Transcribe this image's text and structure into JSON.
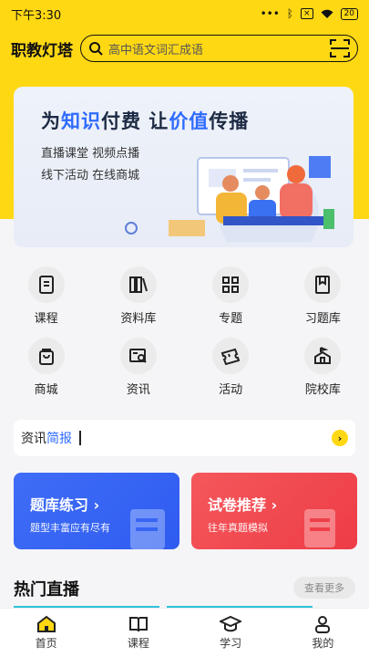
{
  "status": {
    "time": "下午3:30",
    "battery": "20"
  },
  "header": {
    "title": "职教灯塔",
    "search_placeholder": "高中语文词汇成语"
  },
  "banner": {
    "title_a": "为",
    "title_b": "知识",
    "title_c": "付费 让",
    "title_d": "价值",
    "title_e": "传播",
    "line1": "直播课堂 视频点播",
    "line2": "线下活动 在线商城"
  },
  "menu": [
    {
      "label": "课程",
      "icon": "book-icon"
    },
    {
      "label": "资料库",
      "icon": "library-icon"
    },
    {
      "label": "专题",
      "icon": "grid-icon"
    },
    {
      "label": "习题库",
      "icon": "question-book-icon"
    },
    {
      "label": "商城",
      "icon": "shopping-bag-icon"
    },
    {
      "label": "资讯",
      "icon": "news-search-icon"
    },
    {
      "label": "活动",
      "icon": "ticket-icon"
    },
    {
      "label": "院校库",
      "icon": "school-icon"
    }
  ],
  "news": {
    "label_a": "资讯",
    "label_b": "简报"
  },
  "cards": {
    "practice": {
      "title": "题库练习 ›",
      "subtitle": "题型丰富应有尽有"
    },
    "papers": {
      "title": "试卷推荐 ›",
      "subtitle": "往年真题模拟"
    }
  },
  "live": {
    "title": "热门直播",
    "more": "查看更多"
  },
  "tabs": [
    {
      "label": "首页",
      "icon": "home-icon"
    },
    {
      "label": "课程",
      "icon": "open-book-icon"
    },
    {
      "label": "学习",
      "icon": "graduation-cap-icon"
    },
    {
      "label": "我的",
      "icon": "user-icon"
    }
  ],
  "colors": {
    "brand_yellow": "#ffd814",
    "accent_blue": "#2f6bff",
    "card_blue": "#3f6df6",
    "card_red": "#f4585c"
  }
}
